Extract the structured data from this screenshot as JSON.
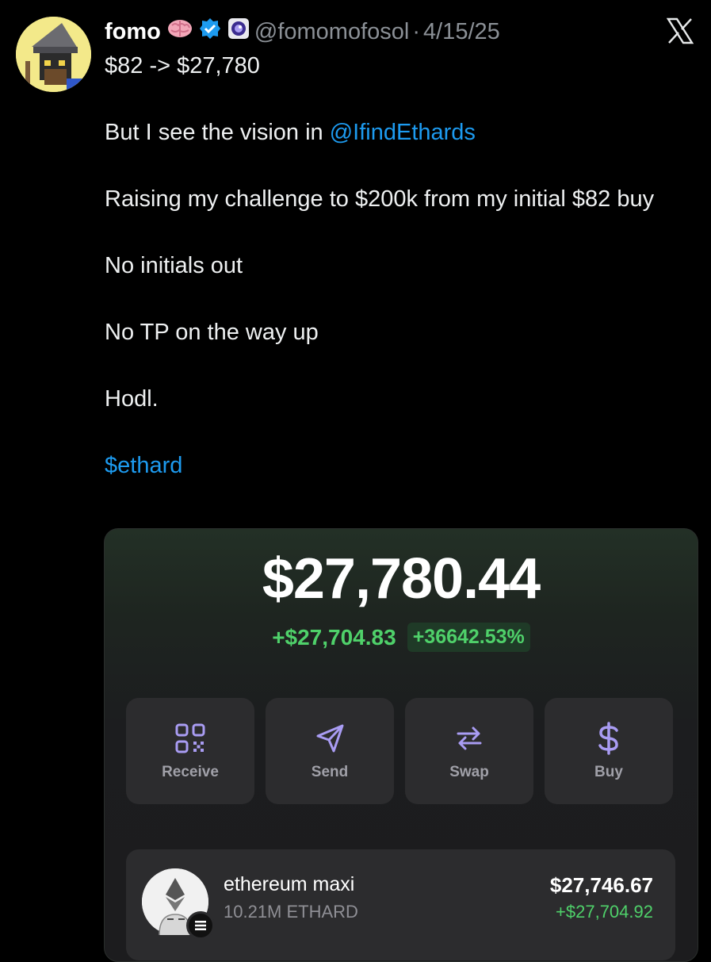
{
  "tweet": {
    "author_name": "fomo",
    "handle": "@fomomofosol",
    "separator": "·",
    "date": "4/15/25",
    "lines": {
      "l1": "$82 -> $27,780",
      "l2_prefix": "But I see the vision in ",
      "l2_mention": "@IfindEthards",
      "l3": "Raising my challenge to $200k from my initial $82 buy",
      "l4": "No initials out",
      "l5": "No TP on the way up",
      "l6": "Hodl.",
      "cashtag": "$ethard"
    }
  },
  "wallet": {
    "balance": "$27,780.44",
    "change_amount": "+$27,704.83",
    "change_percent": "+36642.53%",
    "actions": {
      "receive": "Receive",
      "send": "Send",
      "swap": "Swap",
      "buy": "Buy"
    },
    "token": {
      "name": "ethereum maxi",
      "amount": "10.21M ETHARD",
      "value": "$27,746.67",
      "change": "+$27,704.92"
    }
  },
  "colors": {
    "link": "#1d9bf0",
    "positive": "#4fd16a",
    "verified": "#1d9bf0",
    "accent_icon": "#a99cf3"
  },
  "icons": [
    "brain-icon",
    "verified-badge-icon",
    "affiliate-badge-icon",
    "x-logo-icon",
    "qr-code-icon",
    "send-icon",
    "swap-icon",
    "dollar-icon",
    "solana-badge-icon"
  ]
}
